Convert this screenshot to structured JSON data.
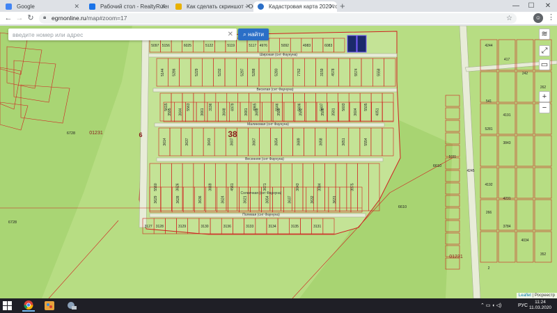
{
  "browser": {
    "tabs": [
      {
        "title": "Google",
        "favicon_color": "#4285f4",
        "active": false
      },
      {
        "title": "Рабочий стол - RealtyRuler",
        "favicon_color": "#1a73e8",
        "active": false
      },
      {
        "title": "Как сделать скриншот - Общи",
        "favicon_color": "#e8b100",
        "active": false
      },
      {
        "title": "Кадастровая карта 2020 года -",
        "favicon_color": "#2b6fc7",
        "active": true
      }
    ],
    "new_tab": "+",
    "window_controls": {
      "minimize": "—",
      "maximize": "☐",
      "close": "✕"
    },
    "url_host": "egrnonline.ru",
    "url_path": "/map#zoom=17",
    "profile_initial": "☺"
  },
  "map": {
    "search_placeholder": "введите номер или адрес",
    "search_button": "найти",
    "street_labels": [
      "Широкая (снт Фаунуна)",
      "Веселая (снт Фаунуна)",
      "Малиновая (снт Фаунуна)",
      "Весенняя (снт Фаунуна)",
      "Солнечная (снт Фаунуна)",
      "Полевая (снт Фаунуна)"
    ],
    "big_labels": [
      "38",
      "6"
    ],
    "quarter_labels": [
      "01231",
      "01231"
    ],
    "free_labels": [
      "6728",
      "6728",
      "6610",
      "6610"
    ],
    "parcels_row1": [
      "5097",
      "5156",
      "6025",
      "5122",
      "5119",
      "5117",
      "4976",
      "5092",
      "4983",
      "6083"
    ],
    "parcels_row2": [
      "5144",
      "5286",
      "5229",
      "5232",
      "5297",
      "5288",
      "5280",
      "7762",
      "3159",
      "4578",
      "5574",
      "5558"
    ],
    "parcels_row3": [
      "5615",
      "5563",
      "3196",
      "6979",
      "4965",
      "5546",
      "5606",
      "5607",
      "5603",
      "5505"
    ],
    "parcels_row4": [
      "3595",
      "3644",
      "3661",
      "3648",
      "3681",
      "3698",
      "3598",
      "3592",
      "3508",
      "3591",
      "3604",
      "4051"
    ],
    "parcels_row5": [
      "3614",
      "3637",
      "3643",
      "3607",
      "3667",
      "3654",
      "3689",
      "3658",
      "3651",
      "5554"
    ],
    "parcels_row6": [
      "3617",
      "3618",
      "3605",
      "5580",
      "3633",
      "3638",
      "3603",
      "3650",
      "1323",
      "3652",
      "2605",
      "3619"
    ],
    "parcels_row7": [
      "5560",
      "3626",
      "3669",
      "4561",
      "3671",
      "3643",
      "3084",
      "3075"
    ],
    "parcels_row8": [
      "3629",
      "3628",
      "3636",
      "3624",
      "3621",
      "3654",
      "3637",
      "3632",
      "3631"
    ],
    "parcels_row9": [
      "3127",
      "3128",
      "3129",
      "3130",
      "3136",
      "3133",
      "3134",
      "3135",
      "3131"
    ],
    "east_parcels": [
      "4244",
      "417",
      "242",
      "262",
      "541",
      "4191",
      "5281",
      "3843",
      "5111",
      "4245",
      "4192",
      "4231",
      "266",
      "3784",
      "4034",
      "352",
      "2"
    ],
    "controls": {
      "layers": "≋",
      "fullscreen": "⤢",
      "ruler": "▭",
      "zoom_in": "+",
      "zoom_out": "−"
    },
    "attribution_link": "Leaflet",
    "attribution_text": "| Росреестр"
  },
  "taskbar": {
    "tray_lang": "РУС",
    "time": "11:24",
    "date": "11.03.2020"
  },
  "colors": {
    "map_bg": "#b7dd83",
    "parcel_border": "#d02020",
    "road": "#e8ecd8",
    "highlight": "#1b2a6b"
  }
}
